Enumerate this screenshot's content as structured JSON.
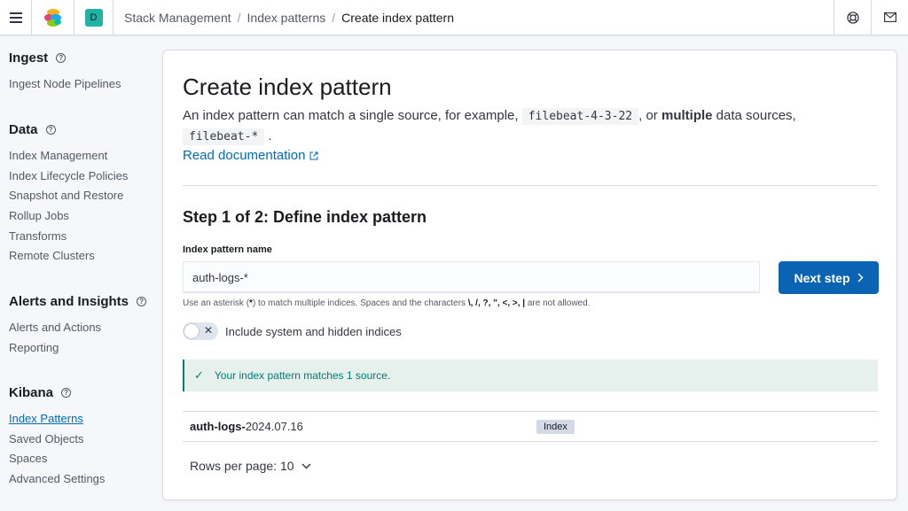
{
  "header": {
    "space_initial": "D",
    "breadcrumbs": [
      "Stack Management",
      "Index patterns",
      "Create index pattern"
    ]
  },
  "sidebar": {
    "sections": [
      {
        "title": "Ingest",
        "items": [
          "Ingest Node Pipelines"
        ]
      },
      {
        "title": "Data",
        "items": [
          "Index Management",
          "Index Lifecycle Policies",
          "Snapshot and Restore",
          "Rollup Jobs",
          "Transforms",
          "Remote Clusters"
        ]
      },
      {
        "title": "Alerts and Insights",
        "items": [
          "Alerts and Actions",
          "Reporting"
        ]
      },
      {
        "title": "Kibana",
        "items": [
          "Index Patterns",
          "Saved Objects",
          "Spaces",
          "Advanced Settings"
        ]
      }
    ],
    "active_item": "Index Patterns"
  },
  "main": {
    "title": "Create index pattern",
    "description": {
      "part1": "An index pattern can match a single source, for example,",
      "code1": "filebeat-4-3-22",
      "part2": ", or",
      "bold": "multiple",
      "part3": "data sources,",
      "code2": "filebeat-*",
      "part4": "."
    },
    "read_doc": "Read documentation",
    "step_title": "Step 1 of 2: Define index pattern",
    "field_label": "Index pattern name",
    "input_value": "auth-logs-*",
    "next_button": "Next step",
    "help": {
      "before": "Use an asterisk (",
      "star": "*",
      "middle": ") to match multiple indices. Spaces and the characters",
      "chars": "\\, /, ?, \", <, >, |",
      "after": "are not allowed."
    },
    "toggle_label": "Include system and hidden indices",
    "toggle_on": false,
    "callout": "Your index pattern matches 1 source.",
    "result": {
      "name_bold": "auth-logs-",
      "name_rest": "2024.07.16",
      "badge": "Index"
    },
    "rows_per_page": "Rows per page: 10"
  },
  "colors": {
    "primary": "#0b64b3",
    "link": "#006bb8",
    "success": "#017d73",
    "space_badge": "#20b2a4"
  }
}
